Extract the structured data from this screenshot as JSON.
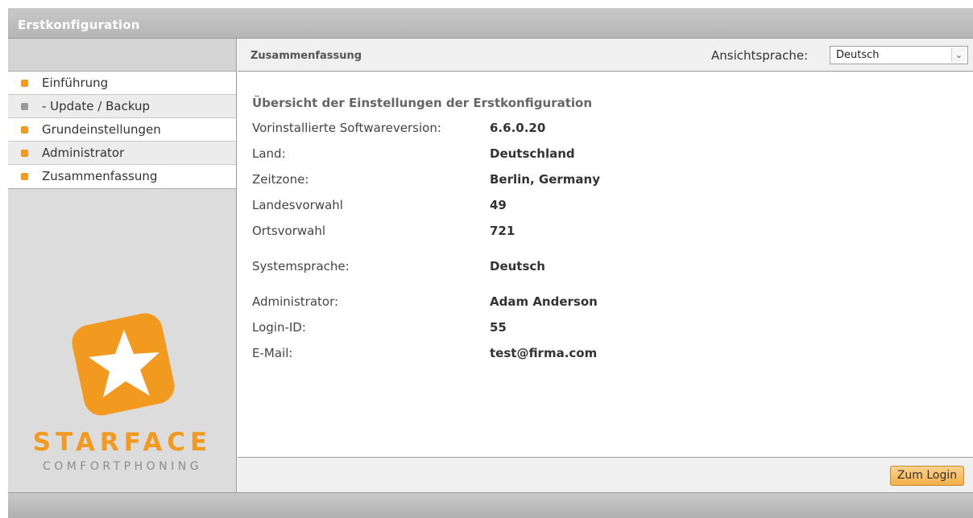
{
  "window": {
    "title": "Erstkonfiguration"
  },
  "sidebar": {
    "items": [
      {
        "label": "Einführung",
        "state": "active"
      },
      {
        "label": "- Update / Backup",
        "state": "inactive"
      },
      {
        "label": "Grundeinstellungen",
        "state": "active"
      },
      {
        "label": "Administrator",
        "state": "active"
      },
      {
        "label": "Zusammenfassung",
        "state": "active"
      }
    ],
    "brand": "STARFACE",
    "tagline": "COMFORTPHONING"
  },
  "header": {
    "title": "Zusammenfassung",
    "language_label": "Ansichtsprache:",
    "language_value": "Deutsch"
  },
  "summary": {
    "title": "Übersicht der Einstellungen der Erstkonfiguration",
    "rows": [
      {
        "label": "Vorinstallierte Softwareversion:",
        "value": "6.6.0.20"
      },
      {
        "label": "Land:",
        "value": "Deutschland"
      },
      {
        "label": "Zeitzone:",
        "value": "Berlin, Germany"
      },
      {
        "label": "Landesvorwahl",
        "value": "49"
      },
      {
        "label": "Ortsvorwahl",
        "value": "721"
      }
    ],
    "system_rows": [
      {
        "label": "Systemsprache:",
        "value": "Deutsch"
      }
    ],
    "admin_rows": [
      {
        "label": "Administrator:",
        "value": "Adam Anderson"
      },
      {
        "label": "Login-ID:",
        "value": "55"
      },
      {
        "label": "E-Mail:",
        "value": "test@firma.com"
      }
    ]
  },
  "footer": {
    "login_button": "Zum Login"
  },
  "colors": {
    "accent": "#f29a1f",
    "inactive_dot": "#9a9a9a"
  }
}
